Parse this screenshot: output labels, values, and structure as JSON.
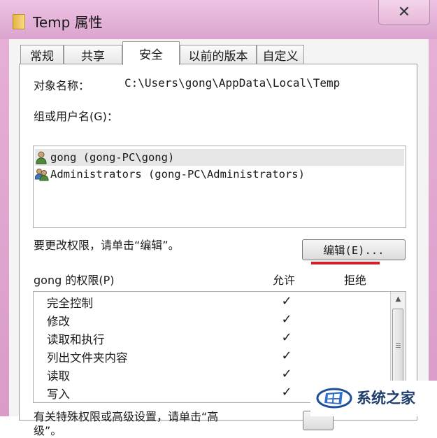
{
  "window": {
    "title": "Temp 属性",
    "close_label": "✕"
  },
  "tabs": [
    {
      "label": "常规",
      "active": false
    },
    {
      "label": "共享",
      "active": false
    },
    {
      "label": "安全",
      "active": true
    },
    {
      "label": "以前的版本",
      "active": false
    },
    {
      "label": "自定义",
      "active": false
    }
  ],
  "security": {
    "object_name_label": "对象名称：",
    "object_name_value": "C:\\Users\\gong\\AppData\\Local\\Temp",
    "group_label": "组或用户名(G)：",
    "users": [
      {
        "name": "gong (gong-PC\\gong)",
        "icon": "user-icon",
        "selected": true
      },
      {
        "name": "Administrators (gong-PC\\Administrators)",
        "icon": "user-group-icon",
        "selected": false
      }
    ],
    "change_hint": "要更改权限，请单击“编辑”。",
    "edit_button": "编辑(E)...",
    "permissions_label": "gong 的权限(P)",
    "allow_header": "允许",
    "deny_header": "拒绝",
    "permissions": [
      {
        "name": "完全控制",
        "allow": "✓",
        "deny": ""
      },
      {
        "name": "修改",
        "allow": "✓",
        "deny": ""
      },
      {
        "name": "读取和执行",
        "allow": "✓",
        "deny": ""
      },
      {
        "name": "列出文件夹内容",
        "allow": "✓",
        "deny": ""
      },
      {
        "name": "读取",
        "allow": "✓",
        "deny": ""
      },
      {
        "name": "写入",
        "allow": "✓",
        "deny": ""
      }
    ],
    "advanced_hint_line1": "有关特殊权限或高级设置，请单击“高",
    "advanced_hint_line2": "级”。"
  },
  "watermark": {
    "text": "系统之家"
  },
  "colors": {
    "frame": "#e2a9d3",
    "highlight_underline": "#d0202a",
    "selected_row": "#e6e6e6"
  }
}
